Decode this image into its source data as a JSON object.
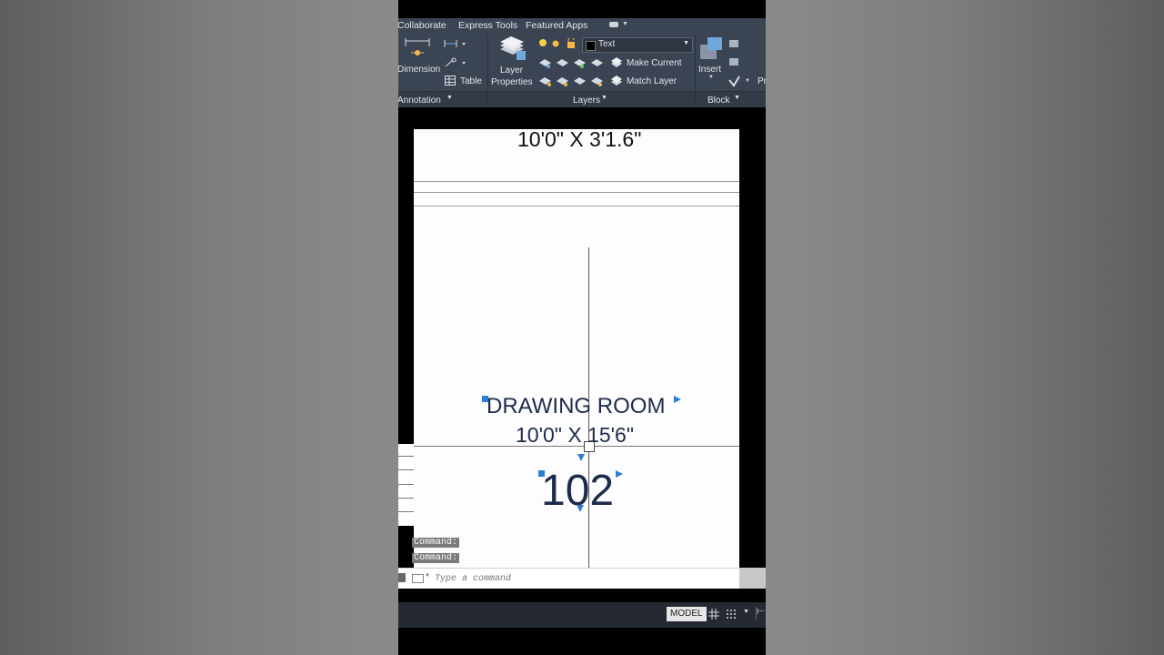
{
  "ribbon": {
    "tabs": [
      "Collaborate",
      "Express Tools",
      "Featured Apps"
    ],
    "annotation": {
      "dimension_label": "Dimension",
      "table_label": "Table",
      "panel_label": "Annotation"
    },
    "layers": {
      "layer_properties_label": "Layer\nProperties",
      "current_layer": "Text",
      "make_current_label": "Make Current",
      "match_layer_label": "Match Layer",
      "panel_label": "Layers"
    },
    "block": {
      "insert_label": "Insert",
      "panel_label": "Block",
      "cut_label": "Pr"
    }
  },
  "drawing": {
    "top_dimension": "10'0\" X 3'1.6\"",
    "room_name": "DRAWING ROOM",
    "room_dimension": "10'0\" X 15'6\"",
    "room_number": "102"
  },
  "command": {
    "history": [
      "Command:",
      "Command:"
    ],
    "placeholder": "Type a command"
  },
  "status": {
    "model_label": "MODEL"
  },
  "colors": {
    "ribbon": "#3b4453",
    "grip": "#2d7fd6",
    "text": "#1d2b4a"
  }
}
